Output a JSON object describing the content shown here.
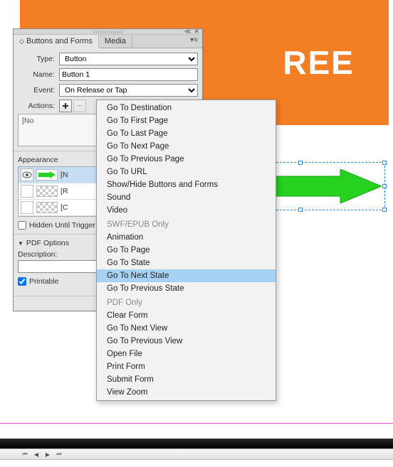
{
  "canvas": {
    "orange_text": "REE"
  },
  "panel": {
    "tabs": {
      "buttons_forms": "Buttons and Forms",
      "media": "Media"
    },
    "type_label": "Type:",
    "type_value": "Button",
    "name_label": "Name:",
    "name_value": "Button 1",
    "event_label": "Event:",
    "event_value": "On Release or Tap",
    "actions_label": "Actions:",
    "no_actions": "[No",
    "appearance_label": "Appearance",
    "appearance": {
      "normal": "[N",
      "rollover": "[R",
      "click": "[C"
    },
    "hidden_label": "Hidden Until Trigger",
    "pdf_options": "PDF Options",
    "description_label": "Description:",
    "printable_label": "Printable"
  },
  "menu": {
    "items": [
      "Go To Destination",
      "Go To First Page",
      "Go To Last Page",
      "Go To Next Page",
      "Go To Previous Page",
      "Go To URL",
      "Show/Hide Buttons and Forms",
      "Sound",
      "Video"
    ],
    "swf_header": "SWF/EPUB Only",
    "swf_items": [
      "Animation",
      "Go To Page",
      "Go To State",
      "Go To Next State",
      "Go To Previous State"
    ],
    "pdf_header": "PDF Only",
    "pdf_items": [
      "Clear Form",
      "Go To Next View",
      "Go To Previous View",
      "Open File",
      "Print Form",
      "Submit Form",
      "View Zoom"
    ],
    "highlighted": "Go To Next State"
  }
}
